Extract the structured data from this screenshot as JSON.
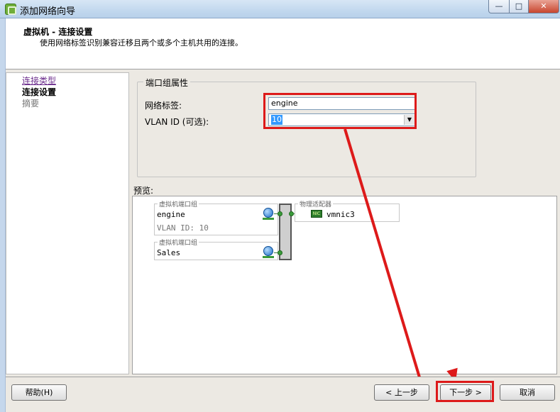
{
  "window": {
    "title": "添加网络向导",
    "minimize": "—",
    "maximize": "□",
    "close": "✕"
  },
  "header": {
    "title": "虚拟机 - 连接设置",
    "subtitle": "使用网络标签识别兼容迁移且两个或多个主机共用的连接。"
  },
  "steps": [
    {
      "label": "连接类型",
      "state": "completed"
    },
    {
      "label": "连接设置",
      "state": "current"
    },
    {
      "label": "摘要",
      "state": "pending"
    }
  ],
  "port_group_props": {
    "legend": "端口组属性",
    "network_label_label": "网络标签:",
    "network_label_value": "engine",
    "vlan_label": "VLAN ID (可选):",
    "vlan_value": "10"
  },
  "preview": {
    "label": "预览:",
    "port_groups": [
      {
        "legend": "虚拟机端口组",
        "name": "engine",
        "vlan": "VLAN ID: 10"
      },
      {
        "legend": "虚拟机端口组",
        "name": "Sales",
        "vlan": ""
      }
    ],
    "adapter_legend": "物理适配器",
    "adapter_name": "vmnic3",
    "nic_icon_text": "NIC"
  },
  "buttons": {
    "help": "帮助(H)",
    "back": "< 上一步",
    "next": "下一步 >",
    "cancel": "取消"
  },
  "annotation_color": "#dd1a1a"
}
